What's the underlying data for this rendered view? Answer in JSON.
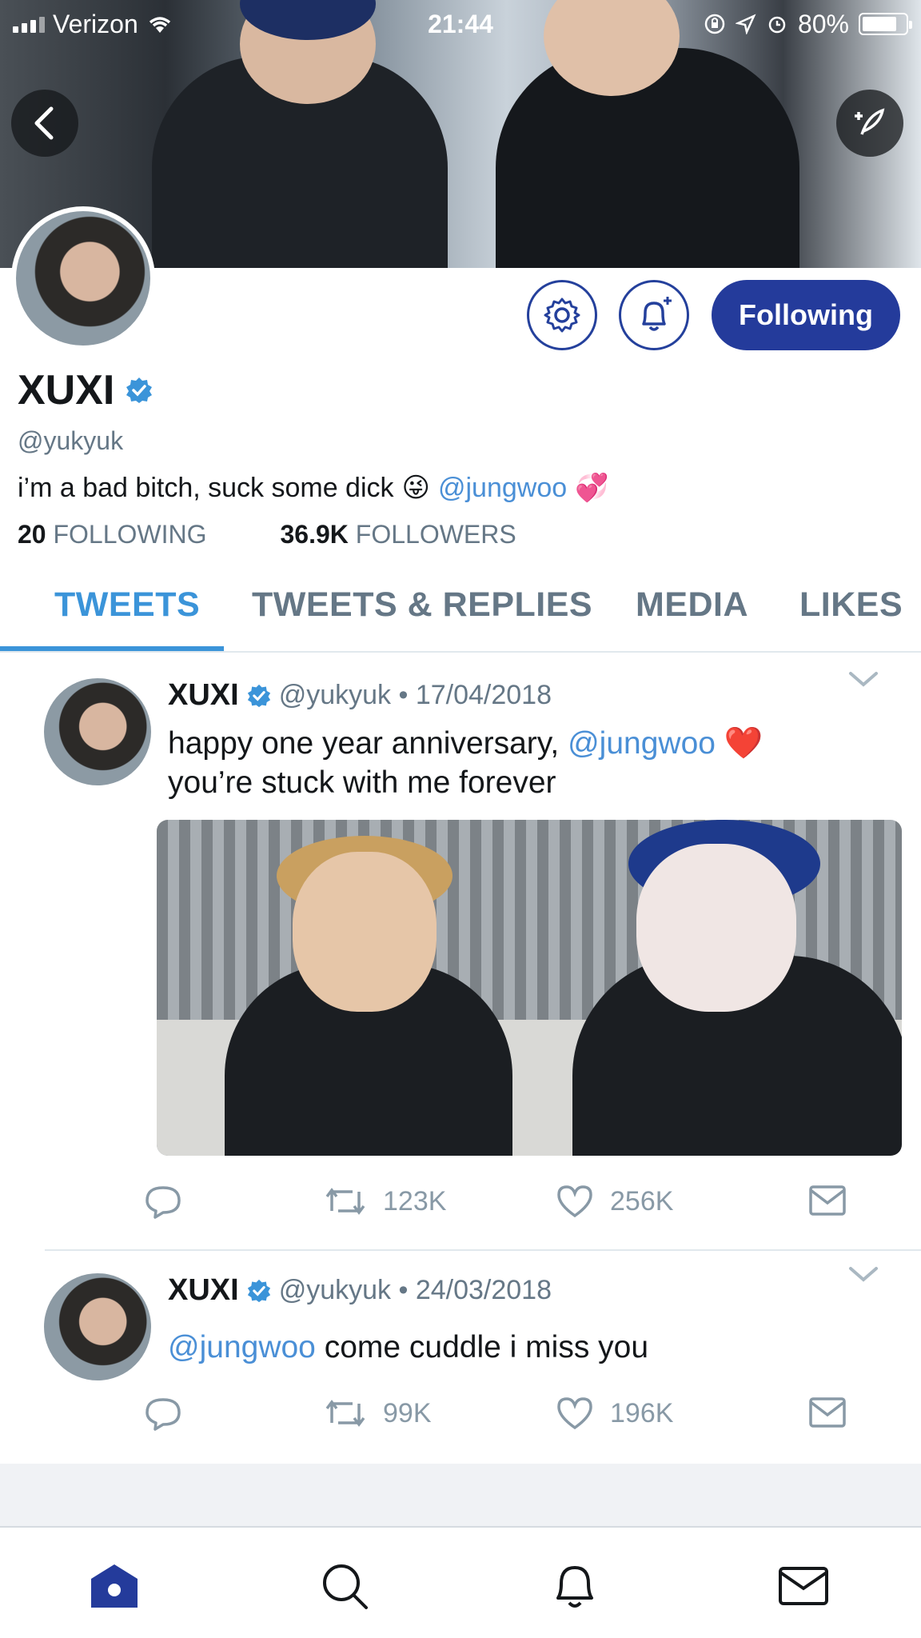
{
  "status_bar": {
    "carrier": "Verizon",
    "time": "21:44",
    "battery": "80%",
    "battery_level": 0.8
  },
  "header": {
    "back_icon": "back-icon",
    "compose_icon": "compose-icon"
  },
  "profile": {
    "display_name": "XUXI",
    "handle": "@yukyuk",
    "bio_text": "i’m a bad bitch, suck some dick",
    "bio_emoji": "😜",
    "bio_mention": "@jungwoo",
    "bio_emoji2": "💞",
    "following_count": "20",
    "following_label": "FOLLOWING",
    "followers_count": "36.9K",
    "followers_label": "FOLLOWERS",
    "following_button": "Following",
    "verified": true
  },
  "tabs": [
    {
      "label": "TWEETS",
      "active": true
    },
    {
      "label": "TWEETS & REPLIES",
      "active": false
    },
    {
      "label": "MEDIA",
      "active": false
    },
    {
      "label": "LIKES",
      "active": false
    }
  ],
  "tweets": [
    {
      "name": "XUXI",
      "meta": "@yukyuk • 17/04/2018",
      "text_before": "happy one year anniversary,",
      "mention": "@jungwoo",
      "emoji": "❤️",
      "text_line2": "you’re stuck with me forever",
      "retweets": "123K",
      "likes": "256K"
    },
    {
      "name": "XUXI",
      "meta": "@yukyuk • 24/03/2018",
      "mention": "@jungwoo",
      "text_after": "come cuddle i miss you",
      "retweets": "99K",
      "likes": "196K"
    }
  ],
  "colors": {
    "accent": "#3b94d9",
    "button": "#243b9b",
    "mention": "#4a8fd6",
    "muted": "#657786"
  }
}
